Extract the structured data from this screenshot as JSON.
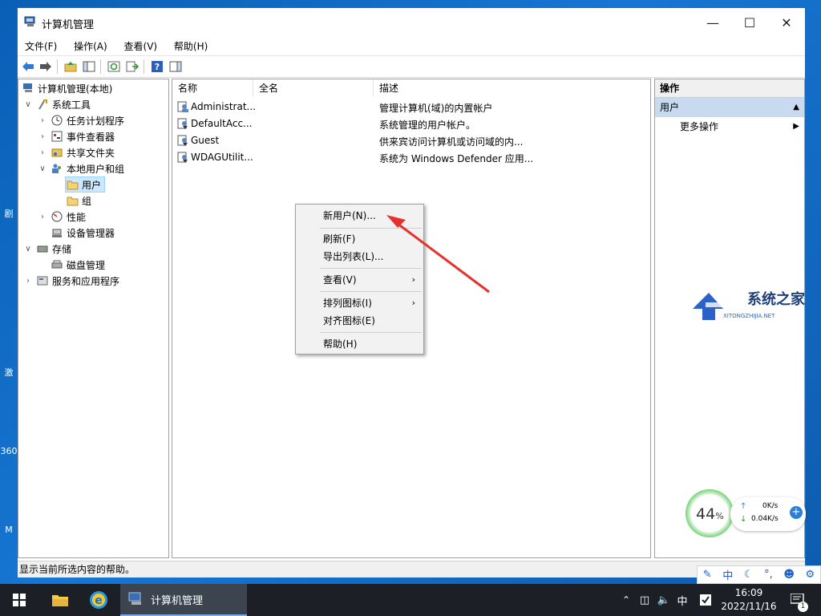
{
  "window": {
    "title": "计算机管理"
  },
  "menu": [
    "文件(F)",
    "操作(A)",
    "查看(V)",
    "帮助(H)"
  ],
  "tree": [
    {
      "label": "计算机管理(本地)",
      "icon": "computer-management-icon",
      "expander": "",
      "level": 0
    },
    {
      "label": "系统工具",
      "icon": "tools-icon",
      "expander": "collapse",
      "level": 1
    },
    {
      "label": "任务计划程序",
      "icon": "clock-icon",
      "expander": "expand",
      "level": 2
    },
    {
      "label": "事件查看器",
      "icon": "event-viewer-icon",
      "expander": "expand",
      "level": 2
    },
    {
      "label": "共享文件夹",
      "icon": "shared-folder-icon",
      "expander": "expand",
      "level": 2
    },
    {
      "label": "本地用户和组",
      "icon": "users-group-icon",
      "expander": "collapse",
      "level": 2
    },
    {
      "label": "用户",
      "icon": "folder-icon",
      "expander": "",
      "level": 3,
      "selected": true
    },
    {
      "label": "组",
      "icon": "folder-icon",
      "expander": "",
      "level": 3
    },
    {
      "label": "性能",
      "icon": "performance-icon",
      "expander": "expand",
      "level": 2
    },
    {
      "label": "设备管理器",
      "icon": "device-manager-icon",
      "expander": "",
      "level": 2
    },
    {
      "label": "存储",
      "icon": "storage-icon",
      "expander": "collapse",
      "level": 1
    },
    {
      "label": "磁盘管理",
      "icon": "disk-icon",
      "expander": "",
      "level": 2
    },
    {
      "label": "服务和应用程序",
      "icon": "services-icon",
      "expander": "expand",
      "level": 1
    }
  ],
  "list": {
    "columns": [
      "名称",
      "全名",
      "描述"
    ],
    "rows": [
      {
        "name": "Administrat...",
        "fullname": "",
        "desc": "管理计算机(域)的内置帐户"
      },
      {
        "name": "DefaultAcc...",
        "fullname": "",
        "desc": "系统管理的用户帐户。"
      },
      {
        "name": "Guest",
        "fullname": "",
        "desc": "供来宾访问计算机或访问域的内..."
      },
      {
        "name": "WDAGUtilit...",
        "fullname": "",
        "desc": "系统为 Windows Defender 应用..."
      }
    ]
  },
  "actions": {
    "header": "操作",
    "section": "用户",
    "more": "更多操作"
  },
  "status": "显示当前所选内容的帮助。",
  "context_menu": [
    {
      "label": "新用户(N)...",
      "submenu": false
    },
    {
      "sep": true
    },
    {
      "label": "刷新(F)",
      "submenu": false
    },
    {
      "label": "导出列表(L)...",
      "submenu": false
    },
    {
      "sep": true
    },
    {
      "label": "查看(V)",
      "submenu": true
    },
    {
      "sep": true
    },
    {
      "label": "排列图标(I)",
      "submenu": true
    },
    {
      "label": "对齐图标(E)",
      "submenu": false
    },
    {
      "sep": true
    },
    {
      "label": "帮助(H)",
      "submenu": false
    }
  ],
  "widget": {
    "percent": "44",
    "percent_unit": "%",
    "up": "0K/s",
    "down": "0.04K/s"
  },
  "ime": [
    "中"
  ],
  "watermark": {
    "title": "系统之家",
    "sub": "XITONGZHIJIA.NET"
  },
  "taskbar": {
    "app_label": "计算机管理",
    "ime": "中",
    "time": "16:09",
    "date": "2022/11/16",
    "notif_count": "1"
  },
  "desktop_edge": [
    "剧",
    "激",
    "360",
    "M"
  ],
  "colors": {
    "accent": "#1f5fc8",
    "annotation_arrow": "#e5322d",
    "selection": "#cce8ff"
  }
}
